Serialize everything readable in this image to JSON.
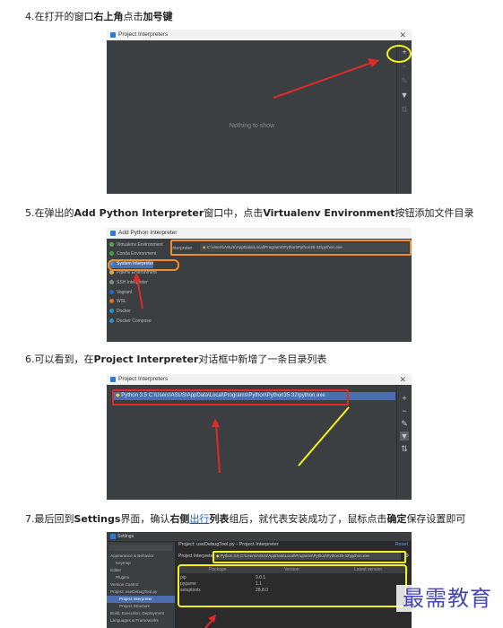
{
  "steps": [
    {
      "prefix": "4.在打开的窗口",
      "bold": "右上角",
      "mid": "点击",
      "bold2": "加号键",
      "suffix": ""
    },
    {
      "prefix": "5.在弹出的",
      "bold": "Add Python Interpreter",
      "mid": "窗口中，点击",
      "bold2": "Virtualenv Environment",
      "suffix": "按钮添加文件目录"
    },
    {
      "prefix": "6.可以看到，在",
      "bold": "Project Interpreter",
      "mid": "对话框中新增了一条目录列表",
      "bold2": "",
      "suffix": ""
    },
    {
      "prefix": "7.最后回到",
      "bold": "Settings",
      "mid": "界面，确认",
      "bold2": "右侧",
      "link": "出行",
      "after_link_bold": "列表",
      "suffix": "组后，就代表安装成功了，鼠标点击",
      "bold3": "确定",
      "end": "保存设置即可"
    }
  ],
  "shot1": {
    "title": "Project Interpreters",
    "close": "✕",
    "message": "Nothing to show",
    "toolbar": [
      "+",
      "−",
      "✎",
      "▼",
      "⇅"
    ]
  },
  "shot2": {
    "title": "Add Python Interpreter",
    "close": "✕",
    "items": [
      {
        "label": "Virtualenv Environment",
        "color": "#5aa55a"
      },
      {
        "label": "Conda Environment",
        "color": "#3fa73f"
      },
      {
        "label": "System Interpreter",
        "color": "#4e8ed6"
      },
      {
        "label": "Pipenv Environment",
        "color": "#d8b040"
      },
      {
        "label": "SSH Interpreter",
        "color": "#888888"
      },
      {
        "label": "Vagrant",
        "color": "#1f6fd0"
      },
      {
        "label": "WSL",
        "color": "#e0702a"
      },
      {
        "label": "Docker",
        "color": "#2596c8"
      },
      {
        "label": "Docker Compose",
        "color": "#2596c8"
      }
    ],
    "field_label": "Interpreter:",
    "field_value": "C:\\Users\\ASUS\\AppData\\Local\\Programs\\Python\\Python35-32\\python.exe"
  },
  "shot3": {
    "title": "Project Interpreters",
    "close": "✕",
    "row": "Python 3.5 C:\\Users\\ASUS\\AppData\\Local\\Programs\\Python\\Python35-32\\python.exe",
    "toolbar": [
      "+",
      "−",
      "✎",
      "▼",
      "⇅"
    ]
  },
  "shot4": {
    "title": "Settings",
    "breadcrumb": "Project: useDebugTool.py  ›  Project Interpreter",
    "reset": "Reset",
    "interp_label": "Project Interpreter:",
    "interp_value": "Python 3.5 C:\\Users\\ASUS\\AppData\\Local\\Programs\\Python\\Python35-32\\python.exe",
    "cols": [
      "Package",
      "Version",
      "Latest version"
    ],
    "rows": [
      [
        "pip",
        "9.0.1",
        ""
      ],
      [
        "pygame",
        "1.1",
        ""
      ],
      [
        "setuptools",
        "28.8.0",
        ""
      ]
    ],
    "nav": [
      "Appearance & Behavior",
      "Keymap",
      "Editor",
      "Plugins",
      "Version Control",
      "Project: useDebugTool.py",
      "Project Interpreter",
      "Project Structure",
      "Build, Execution, Deployment",
      "Languages & Frameworks"
    ]
  },
  "watermark": "最需教育",
  "colors": {
    "highlight": "#f08c2c",
    "yellow": "#f3f21a",
    "red_arrow": "#e02a2a",
    "dark_bg": "#3c3f41",
    "selection": "#4b6eaf"
  }
}
